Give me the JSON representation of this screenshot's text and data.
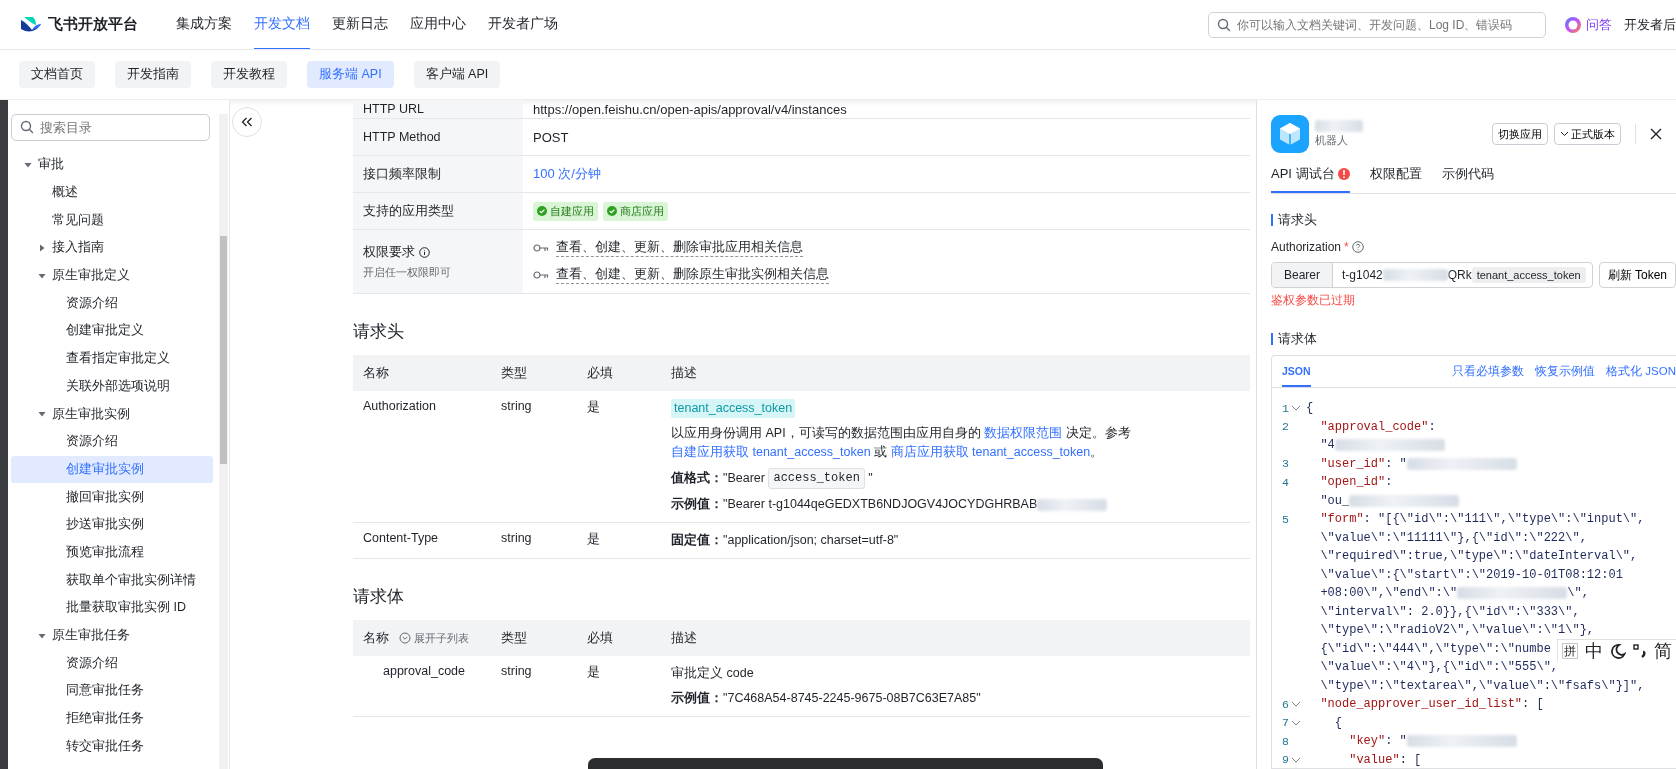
{
  "top_nav": {
    "logo": "飞书开放平台",
    "items": [
      {
        "label": "集成方案",
        "selected": false
      },
      {
        "label": "开发文档",
        "selected": true
      },
      {
        "label": "更新日志",
        "selected": false
      },
      {
        "label": "应用中心",
        "selected": false
      },
      {
        "label": "开发者广场",
        "selected": false
      }
    ],
    "search": {
      "placeholder": "你可以输入文档关键词、开发问题、Log ID、错误码"
    },
    "ask": "问答",
    "console": "开发者后"
  },
  "sub_nav": [
    {
      "label": "文档首页",
      "selected": false
    },
    {
      "label": "开发指南",
      "selected": false
    },
    {
      "label": "开发教程",
      "selected": false
    },
    {
      "label": "服务端 API",
      "selected": true
    },
    {
      "label": "客户端 API",
      "selected": false
    }
  ],
  "sidebar": {
    "search": {
      "placeholder": "搜索目录"
    },
    "tree": [
      {
        "label": "审批",
        "expanded": true,
        "selected": false,
        "children": [
          {
            "label": "概述",
            "selected": false
          },
          {
            "label": "常见问题",
            "selected": false
          },
          {
            "label": "接入指南",
            "expanded": false,
            "selected": false
          },
          {
            "label": "原生审批定义",
            "expanded": true,
            "selected": false,
            "children": [
              {
                "label": "资源介绍",
                "selected": false
              },
              {
                "label": "创建审批定义",
                "selected": false
              },
              {
                "label": "查看指定审批定义",
                "selected": false
              },
              {
                "label": "关联外部选项说明",
                "selected": false
              }
            ]
          },
          {
            "label": "原生审批实例",
            "expanded": true,
            "selected": false,
            "children": [
              {
                "label": "资源介绍",
                "selected": false
              },
              {
                "label": "创建审批实例",
                "selected": true
              },
              {
                "label": "撤回审批实例",
                "selected": false
              },
              {
                "label": "抄送审批实例",
                "selected": false
              },
              {
                "label": "预览审批流程",
                "selected": false
              },
              {
                "label": "获取单个审批实例详情",
                "selected": false
              },
              {
                "label": "批量获取审批实例 ID",
                "selected": false
              }
            ]
          },
          {
            "label": "原生审批任务",
            "expanded": true,
            "selected": false,
            "children": [
              {
                "label": "资源介绍",
                "selected": false
              },
              {
                "label": "同意审批任务",
                "selected": false
              },
              {
                "label": "拒绝审批任务",
                "selected": false
              },
              {
                "label": "转交审批任务",
                "selected": false
              }
            ]
          }
        ]
      }
    ]
  },
  "info_table": [
    {
      "label": "HTTP URL",
      "kind": "text",
      "value": "https://open.feishu.cn/open-apis/approval/v4/instances"
    },
    {
      "label": "HTTP Method",
      "kind": "text",
      "value": "POST"
    },
    {
      "label": "接口频率限制",
      "kind": "link",
      "value": "100 次/分钟"
    },
    {
      "label": "支持的应用类型",
      "kind": "tags",
      "tags": [
        "自建应用",
        "商店应用"
      ]
    },
    {
      "label": "权限要求",
      "kind": "permissions",
      "hint": "开启任一权限即可",
      "items": [
        "查看、创建、更新、删除审批应用相关信息",
        "查看、创建、更新、删除原生审批实例相关信息"
      ]
    }
  ],
  "request_header": {
    "title": "请求头",
    "columns": [
      {
        "label": "名称"
      },
      {
        "label": "类型"
      },
      {
        "label": "必填"
      },
      {
        "label": "描述"
      }
    ],
    "rows": [
      {
        "name": "Authorization",
        "type": "string",
        "required": "是",
        "desc": [
          {
            "kind": "token",
            "text": "tenant_access_token"
          },
          {
            "kind": "paragraph",
            "parts": [
              {
                "kind": "text",
                "text": "以应用身份调用 API，可读写的数据范围由应用自身的 "
              },
              {
                "kind": "link",
                "text": "数据权限范围"
              },
              {
                "kind": "text",
                "text": " 决定。参考 "
              },
              {
                "kind": "link",
                "text": "自建应用获取 tenant_access_token"
              },
              {
                "kind": "text",
                "text": " 或 "
              },
              {
                "kind": "link",
                "text": "商店应用获取 tenant_access_token"
              },
              {
                "kind": "text",
                "text": "。"
              }
            ]
          },
          {
            "kind": "labeled",
            "label": "值格式：",
            "parts": [
              {
                "kind": "text",
                "text": "\"Bearer "
              },
              {
                "kind": "code",
                "text": "access_token"
              },
              {
                "kind": "text",
                "text": " \""
              }
            ]
          },
          {
            "kind": "labeled",
            "label": "示例值：",
            "parts": [
              {
                "kind": "text",
                "text": "\"Bearer t-g1044qeGEDXTB6NDJOGV4JOCYDGHRBAB"
              },
              {
                "kind": "blur"
              }
            ]
          }
        ]
      },
      {
        "name": "Content-Type",
        "type": "string",
        "required": "是",
        "desc": [
          {
            "kind": "labeled",
            "label": "固定值：",
            "parts": [
              {
                "kind": "text",
                "text": "\"application/json; charset=utf-8\""
              }
            ]
          }
        ]
      }
    ]
  },
  "request_body": {
    "title": "请求体",
    "columns": [
      {
        "label": "名称",
        "action": "展开子列表"
      },
      {
        "label": "类型"
      },
      {
        "label": "必填"
      },
      {
        "label": "描述"
      }
    ],
    "rows": [
      {
        "name": "approval_code",
        "type": "string",
        "required": "是",
        "desc": [
          {
            "kind": "paragraph",
            "parts": [
              {
                "kind": "text",
                "text": "审批定义 code"
              }
            ]
          },
          {
            "kind": "labeled",
            "label": "示例值：",
            "parts": [
              {
                "kind": "text",
                "text": "\"7C468A54-8745-2245-9675-08B7C63E7A85\""
              }
            ]
          }
        ]
      }
    ]
  },
  "panel": {
    "app_subtitle": "机器人",
    "switch_button": "切换应用",
    "version_button": "正式版本",
    "tabs": [
      {
        "label": "API 调试台",
        "selected": true,
        "alert": true
      },
      {
        "label": "权限配置",
        "selected": false,
        "alert": false
      },
      {
        "label": "示例代码",
        "selected": false,
        "alert": false
      }
    ],
    "header_section": "请求头",
    "auth": {
      "label": "Authorization",
      "required_mark": "*",
      "prefix": "Bearer",
      "value_start": "t-g1042",
      "value_end": "QRk",
      "token_tag": "tenant_access_token",
      "refresh": "刷新 Token",
      "error": "鉴权参数已过期"
    },
    "body_section": "请求体",
    "editor": {
      "tabs": [
        {
          "label": "JSON",
          "selected": true
        }
      ],
      "actions": [
        "只看必填参数",
        "恢复示例值",
        "格式化 JSON"
      ],
      "lines": [
        {
          "num": "1",
          "fold": true,
          "parts": [
            {
              "kind": "value",
              "text": "{"
            }
          ]
        },
        {
          "num": "2",
          "parts": [
            {
              "kind": "key",
              "text": "  \"approval_code\""
            },
            {
              "kind": "value",
              "text": ":"
            }
          ]
        },
        {
          "parts": [
            {
              "kind": "value",
              "text": "  \"4"
            },
            {
              "kind": "blur"
            }
          ]
        },
        {
          "num": "3",
          "parts": [
            {
              "kind": "key",
              "text": "  \"user_id\""
            },
            {
              "kind": "value",
              "text": ": \""
            },
            {
              "kind": "blur"
            }
          ]
        },
        {
          "num": "4",
          "parts": [
            {
              "kind": "key",
              "text": "  \"open_id\""
            },
            {
              "kind": "value",
              "text": ":"
            }
          ]
        },
        {
          "parts": [
            {
              "kind": "value",
              "text": "  \"ou_"
            },
            {
              "kind": "blur"
            }
          ]
        },
        {
          "num": "5",
          "parts": [
            {
              "kind": "key",
              "text": "  \"form\""
            },
            {
              "kind": "value",
              "text": ": \"[{\\\"id\\\":\\\"111\\\",\\\"type\\\":\\\"input\\\","
            }
          ]
        },
        {
          "parts": [
            {
              "kind": "value",
              "text": "  \\\"value\\\":\\\"11111\\\"},{\\\"id\\\":\\\"222\\\","
            }
          ]
        },
        {
          "parts": [
            {
              "kind": "value",
              "text": "  \\\"required\\\":true,\\\"type\\\":\\\"dateInterval\\\","
            }
          ]
        },
        {
          "parts": [
            {
              "kind": "value",
              "text": "  \\\"value\\\":{\\\"start\\\":\\\"2019-10-01T08:12:01"
            }
          ]
        },
        {
          "parts": [
            {
              "kind": "value",
              "text": "  +08:00\\\",\\\"end\\\":\\\""
            },
            {
              "kind": "blur"
            },
            {
              "kind": "value",
              "text": "\\\","
            }
          ]
        },
        {
          "parts": [
            {
              "kind": "value",
              "text": "  \\\"interval\\\": 2.0}},{\\\"id\\\":\\\"333\\\","
            }
          ]
        },
        {
          "parts": [
            {
              "kind": "value",
              "text": "  \\\"type\\\":\\\"radioV2\\\",\\\"value\\\":\\\"1\\\"},"
            }
          ]
        },
        {
          "parts": [
            {
              "kind": "value",
              "text": "  {\\\"id\\\":\\\"444\\\",\\\"type\\\":\\\"numbe"
            }
          ]
        },
        {
          "parts": [
            {
              "kind": "value",
              "text": "  \\\"value\\\":\\\"4\\\"},{\\\"id\\\":\\\"555\\\","
            }
          ]
        },
        {
          "parts": [
            {
              "kind": "value",
              "text": "  \\\"type\\\":\\\"textarea\\\",\\\"value\\\":\\\"fsafs\\\"}]\","
            }
          ]
        },
        {
          "num": "6",
          "fold": true,
          "parts": [
            {
              "kind": "key",
              "text": "  \"node_approver_user_id_list\""
            },
            {
              "kind": "value",
              "text": ": ["
            }
          ]
        },
        {
          "num": "7",
          "fold": true,
          "parts": [
            {
              "kind": "value",
              "text": "    {"
            }
          ]
        },
        {
          "num": "8",
          "parts": [
            {
              "kind": "key",
              "text": "      \"key\""
            },
            {
              "kind": "value",
              "text": ": \""
            },
            {
              "kind": "blur"
            }
          ]
        },
        {
          "num": "9",
          "fold": true,
          "parts": [
            {
              "kind": "key",
              "text": "      \"value\""
            },
            {
              "kind": "value",
              "text": ": ["
            }
          ]
        }
      ]
    }
  },
  "ime": {
    "pinyin": "拼",
    "mode": "中",
    "simplified": "简"
  }
}
